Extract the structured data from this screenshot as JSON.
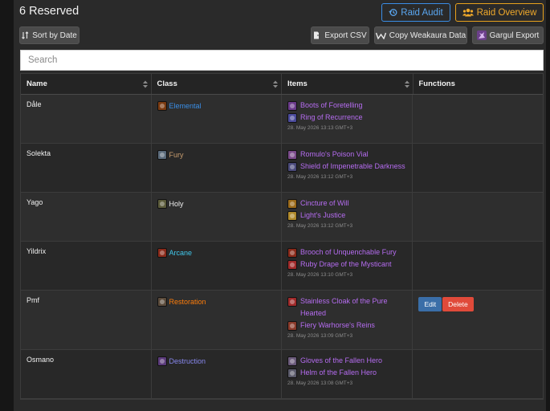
{
  "header": {
    "title": "6 Reserved",
    "raid_audit_label": "Raid Audit",
    "raid_overview_label": "Raid Overview",
    "colors": {
      "audit": "#3a8ee6",
      "overview": "#e8a21c"
    }
  },
  "toolbar": {
    "sort_label": "Sort by Date",
    "export_csv_label": "Export CSV",
    "copy_wa_label": "Copy Weakaura Data",
    "gargul_label": "Gargul Export"
  },
  "search": {
    "placeholder": "Search",
    "value": ""
  },
  "table": {
    "columns": [
      "Name",
      "Class",
      "Items",
      "Functions"
    ],
    "rows": [
      {
        "name": "Dåle",
        "class_label": "Elemental",
        "class_color": "#3a8ee6",
        "class_icon": "lightning-icon",
        "items": [
          {
            "label": "Boots of Foretelling",
            "icon": "boots-icon"
          },
          {
            "label": "Ring of Recurrence",
            "icon": "ring-icon"
          }
        ],
        "timestamp": "28. May 2026 13:13 GMT+3",
        "functions": []
      },
      {
        "name": "Solekta",
        "class_label": "Fury",
        "class_color": "#c79c6e",
        "class_icon": "sword-icon",
        "items": [
          {
            "label": "Romulo's Poison Vial",
            "icon": "vial-icon"
          },
          {
            "label": "Shield of Impenetrable Darkness",
            "icon": "shield-icon"
          }
        ],
        "timestamp": "28. May 2026 13:12 GMT+3",
        "functions": []
      },
      {
        "name": "Yago",
        "class_label": "Holy",
        "class_color": "#f0f0f0",
        "class_icon": "holy-icon",
        "items": [
          {
            "label": "Cincture of Will",
            "icon": "belt-icon"
          },
          {
            "label": "Light's Justice",
            "icon": "mace-icon"
          }
        ],
        "timestamp": "28. May 2026 13:12 GMT+3",
        "functions": []
      },
      {
        "name": "Yildrix",
        "class_label": "Arcane",
        "class_color": "#40c7eb",
        "class_icon": "arcane-icon",
        "items": [
          {
            "label": "Brooch of Unquenchable Fury",
            "icon": "brooch-icon"
          },
          {
            "label": "Ruby Drape of the Mysticant",
            "icon": "cloak-icon"
          }
        ],
        "timestamp": "28. May 2026 13:10 GMT+3",
        "functions": []
      },
      {
        "name": "Pmf",
        "class_label": "Restoration",
        "class_color": "#ff7d0a",
        "class_icon": "restoration-icon",
        "items": [
          {
            "label": "Stainless Cloak of the Pure Hearted",
            "icon": "cloak-icon"
          },
          {
            "label": "Fiery Warhorse's Reins",
            "icon": "reins-icon"
          }
        ],
        "timestamp": "28. May 2026 13:09 GMT+3",
        "functions": [
          "Edit",
          "Delete"
        ]
      },
      {
        "name": "Osmano",
        "class_label": "Destruction",
        "class_color": "#8787ed",
        "class_icon": "destruction-icon",
        "items": [
          {
            "label": "Gloves of the Fallen Hero",
            "icon": "gloves-icon"
          },
          {
            "label": "Helm of the Fallen Hero",
            "icon": "helm-icon"
          }
        ],
        "timestamp": "28. May 2026 13:08 GMT+3",
        "functions": []
      }
    ]
  }
}
